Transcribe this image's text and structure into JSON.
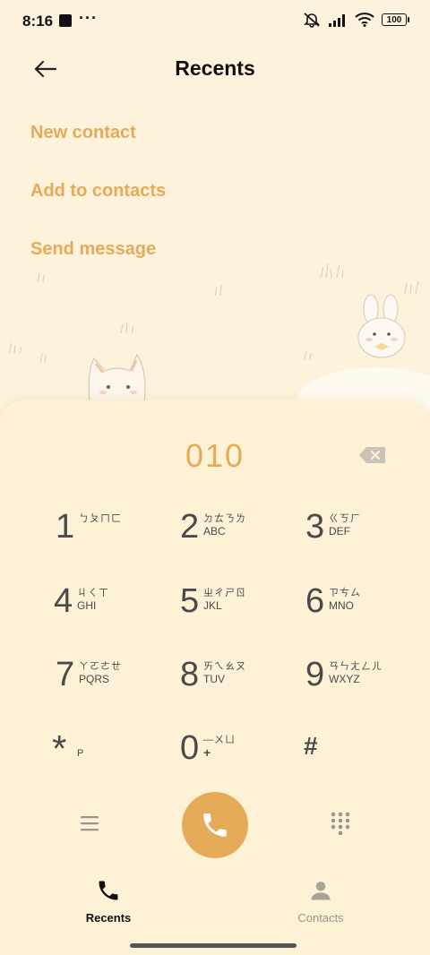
{
  "status_bar": {
    "time": "8:16",
    "dots": "···",
    "battery": "100"
  },
  "header": {
    "title": "Recents"
  },
  "menu": [
    {
      "label": "New contact"
    },
    {
      "label": "Add to contacts"
    },
    {
      "label": "Send message"
    }
  ],
  "dialer": {
    "number": "010",
    "keys": [
      {
        "digit": "1",
        "zhuyin": "ㄅㄆㄇㄈ",
        "letters": ""
      },
      {
        "digit": "2",
        "zhuyin": "ㄉㄊㄋㄌ",
        "letters": "ABC"
      },
      {
        "digit": "3",
        "zhuyin": "ㄍㄎㄏ",
        "letters": "DEF"
      },
      {
        "digit": "4",
        "zhuyin": "ㄐㄑㄒ",
        "letters": "GHI"
      },
      {
        "digit": "5",
        "zhuyin": "ㄓㄔㄕㄖ",
        "letters": "JKL"
      },
      {
        "digit": "6",
        "zhuyin": "ㄗㄘㄙ",
        "letters": "MNO"
      },
      {
        "digit": "7",
        "zhuyin": "ㄚㄛㄜㄝ",
        "letters": "PQRS"
      },
      {
        "digit": "8",
        "zhuyin": "ㄞㄟㄠㄡ",
        "letters": "TUV"
      },
      {
        "digit": "9",
        "zhuyin": "ㄢㄣㄤㄥㄦ",
        "letters": "WXYZ"
      },
      {
        "digit": "*",
        "zhuyin": "",
        "letters": "P"
      },
      {
        "digit": "0",
        "zhuyin": "—ㄨㄩ",
        "letters": "+"
      },
      {
        "digit": "#",
        "zhuyin": "",
        "letters": ""
      }
    ]
  },
  "bottom_nav": [
    {
      "label": "Recents",
      "active": true
    },
    {
      "label": "Contacts",
      "active": false
    }
  ],
  "colors": {
    "accent": "#e6ab58",
    "background": "#fdf2dc"
  }
}
